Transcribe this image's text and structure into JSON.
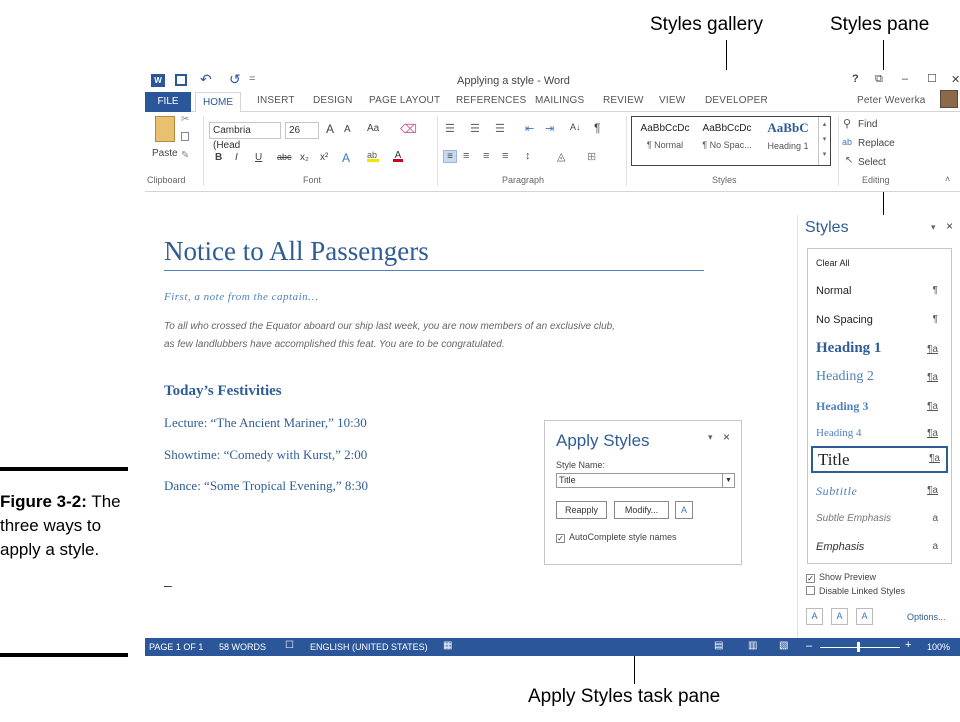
{
  "callouts": {
    "styles_gallery": "Styles gallery",
    "styles_pane": "Styles pane",
    "apply_styles_task_pane": "Apply Styles task pane"
  },
  "figure": {
    "label": "Figure 3-2:",
    "caption": "The three ways to apply a style."
  },
  "titlebar": {
    "undo": "↶",
    "redo": "↺",
    "qat_more": "=",
    "title": "Applying a style - Word",
    "help": "?",
    "restore": "⧉",
    "minimize": "–",
    "maximize": "☐",
    "close": "✕"
  },
  "tabs": {
    "file": "FILE",
    "home": "HOME",
    "insert": "INSERT",
    "design": "DESIGN",
    "page_layout": "PAGE LAYOUT",
    "references": "REFERENCES",
    "mailings": "MAILINGS",
    "review": "REVIEW",
    "view": "VIEW",
    "developer": "DEVELOPER",
    "user": "Peter Weverka"
  },
  "ribbon": {
    "clipboard": {
      "paste": "Paste",
      "group": "Clipboard"
    },
    "font": {
      "name": "Cambria (Head",
      "size": "26",
      "grow": "A",
      "shrink": "A",
      "case": "Aa",
      "bold": "B",
      "italic": "I",
      "underline": "U",
      "strike": "abc",
      "sub": "x₂",
      "sup": "x²",
      "group": "Font"
    },
    "paragraph": {
      "sort": "A↓",
      "pilcrow": "¶",
      "group": "Paragraph"
    },
    "styles": {
      "items": [
        {
          "preview": "AaBbCcDc",
          "name": "¶ Normal"
        },
        {
          "preview": "AaBbCcDc",
          "name": "¶ No Spac..."
        },
        {
          "preview": "AaBbC",
          "name": "Heading 1"
        }
      ],
      "group": "Styles"
    },
    "editing": {
      "find": "Find",
      "replace": "Replace",
      "select": "Select",
      "group": "Editing"
    }
  },
  "document": {
    "title": "Notice to All Passengers",
    "intro": "First, a note from the captain…",
    "body1": "To all who crossed the Equator aboard our ship last week, you are now members of an exclusive club,",
    "body2": "as few landlubbers have accomplished this feat. You are to be congratulated.",
    "heading": "Today’s Festivities",
    "lines": [
      "Lecture: “The Ancient Mariner,” 10:30",
      "Showtime: “Comedy with Kurst,” 2:00",
      "Dance: “Some Tropical Evening,” 8:30"
    ],
    "cursor": "–"
  },
  "apply_styles": {
    "title": "Apply Styles",
    "style_name_label": "Style Name:",
    "style_name_value": "Title",
    "reapply": "Reapply",
    "modify": "Modify...",
    "autocomplete": "AutoComplete style names",
    "checkmark": "✓",
    "close": "×",
    "pin": "▾"
  },
  "styles_pane": {
    "title": "Styles",
    "close": "×",
    "pin": "▾",
    "items": [
      {
        "name": "Clear All",
        "mark": ""
      },
      {
        "name": "Normal",
        "mark": "¶"
      },
      {
        "name": "No Spacing",
        "mark": "¶"
      },
      {
        "name": "Heading 1",
        "mark": "¶a"
      },
      {
        "name": "Heading 2",
        "mark": "¶a"
      },
      {
        "name": "Heading 3",
        "mark": "¶a"
      },
      {
        "name": "Heading 4",
        "mark": "¶a"
      },
      {
        "name": "Title",
        "mark": "¶a"
      },
      {
        "name": "Subtitle",
        "mark": "¶a"
      },
      {
        "name": "Subtle Emphasis",
        "mark": "a"
      },
      {
        "name": "Emphasis",
        "mark": "a"
      }
    ],
    "show_preview": "Show Preview",
    "disable_linked": "Disable Linked Styles",
    "checkmark": "✓",
    "options": "Options..."
  },
  "statusbar": {
    "page": "PAGE 1 OF 1",
    "words": "58 WORDS",
    "language": "ENGLISH (UNITED STATES)",
    "zoom": "100%"
  },
  "colors": {
    "accent": "#2b579a",
    "heading": "#2e5d96"
  }
}
